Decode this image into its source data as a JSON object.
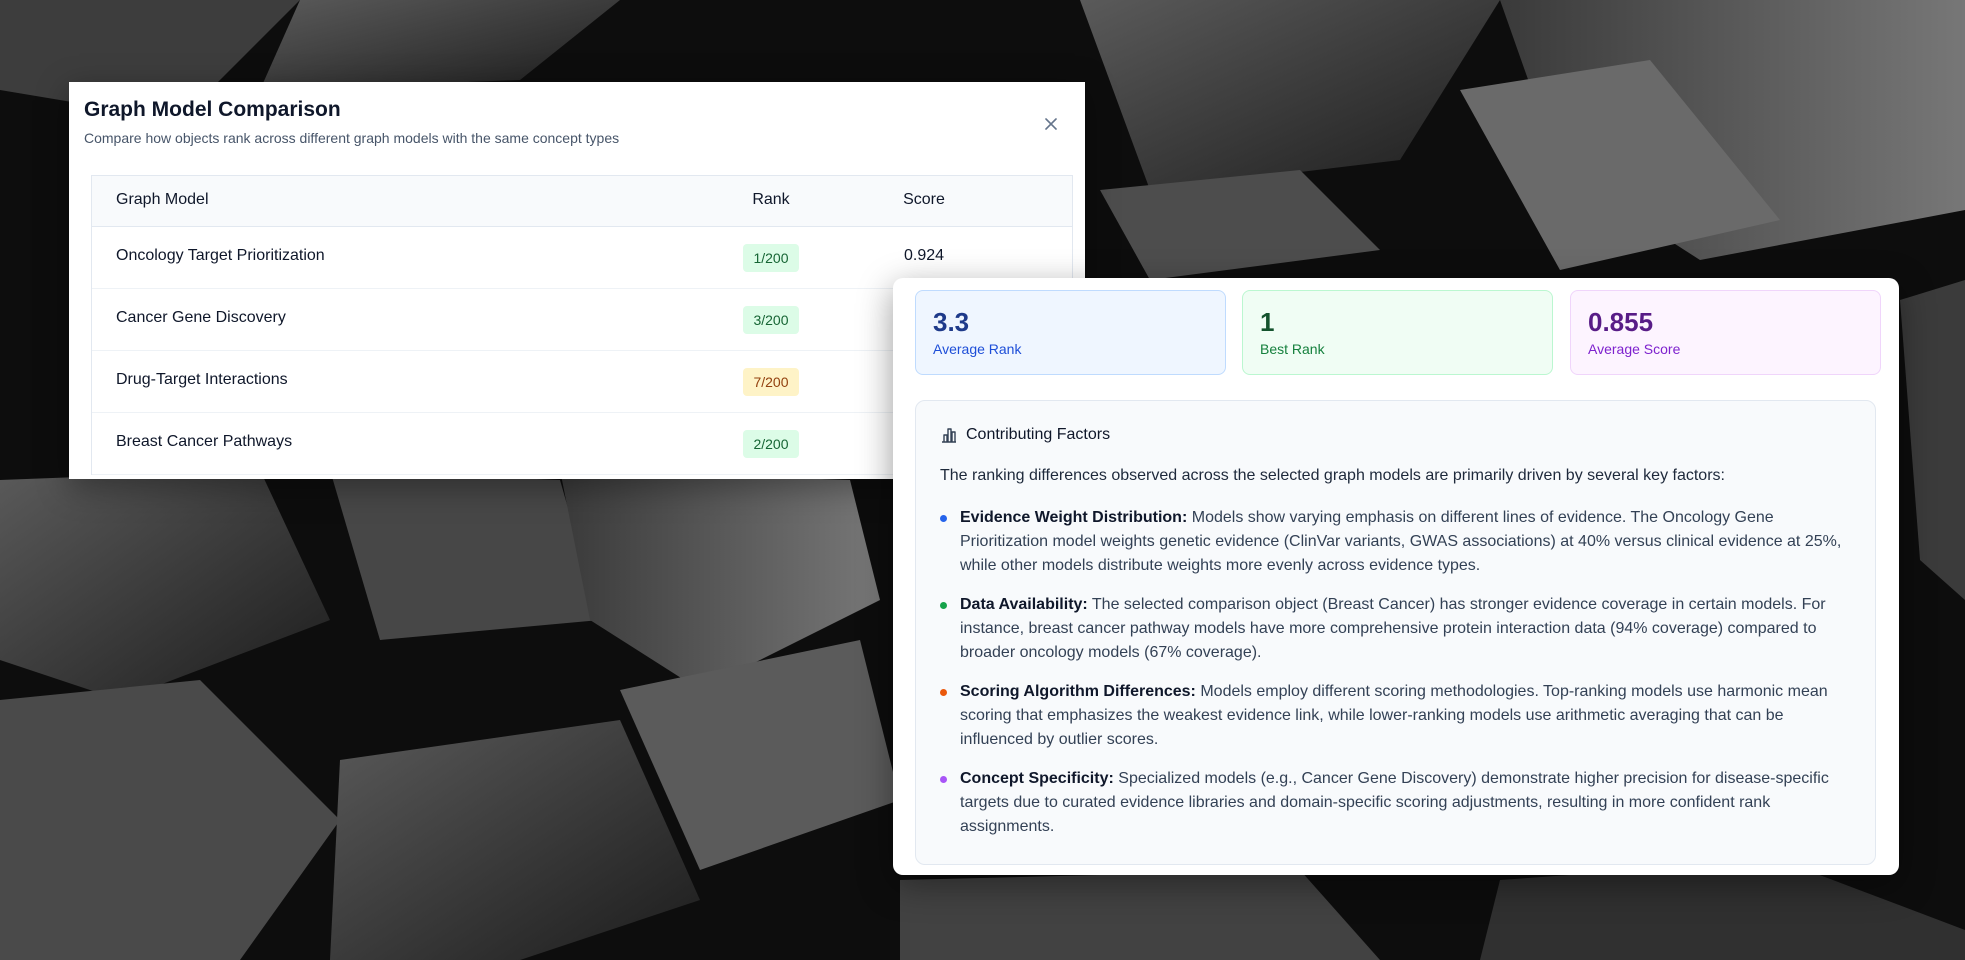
{
  "comparison": {
    "title": "Graph Model Comparison",
    "subtitle": "Compare how objects rank across different graph models with the same concept types",
    "close_icon": "close-icon",
    "columns": [
      "Graph Model",
      "Rank",
      "Score"
    ],
    "rows": [
      {
        "model": "Oncology Target Prioritization",
        "rank": "1/200",
        "rank_color": "green",
        "score": "0.924"
      },
      {
        "model": "Cancer Gene Discovery",
        "rank": "3/200",
        "rank_color": "green",
        "score": ""
      },
      {
        "model": "Drug-Target Interactions",
        "rank": "7/200",
        "rank_color": "yellow",
        "score": ""
      },
      {
        "model": "Breast Cancer Pathways",
        "rank": "2/200",
        "rank_color": "green",
        "score": ""
      }
    ]
  },
  "stats": [
    {
      "value": "3.3",
      "label": "Average Rank",
      "color": "#1d4ed8"
    },
    {
      "value": "1",
      "label": "Best Rank",
      "color": "#15803d"
    },
    {
      "value": "0.855",
      "label": "Average Score",
      "color": "#7e22ce"
    }
  ],
  "factors": {
    "icon": "bar-chart-icon",
    "title": "Contributing Factors",
    "intro": "The ranking differences observed across the selected graph models are primarily driven by several key factors:",
    "items": [
      {
        "heading": "Evidence Weight Distribution:",
        "text": "Models show varying emphasis on different lines of evidence. The Oncology Gene Prioritization model weights genetic evidence (ClinVar variants, GWAS associations) at 40% versus clinical evidence at 25%, while other models distribute weights more evenly across evidence types.",
        "dot_color": "#2563eb"
      },
      {
        "heading": "Data Availability:",
        "text": "The selected comparison object (Breast Cancer) has stronger evidence coverage in certain models. For instance, breast cancer pathway models have more comprehensive protein interaction data (94% coverage) compared to broader oncology models (67% coverage).",
        "dot_color": "#16a34a"
      },
      {
        "heading": "Scoring Algorithm Differences:",
        "text": "Models employ different scoring methodologies. Top-ranking models use harmonic mean scoring that emphasizes the weakest evidence link, while lower-ranking models use arithmetic averaging that can be influenced by outlier scores.",
        "dot_color": "#ea580c"
      },
      {
        "heading": "Concept Specificity:",
        "text": "Specialized models (e.g., Cancer Gene Discovery) demonstrate higher precision for disease-specific targets due to curated evidence libraries and domain-specific scoring adjustments, resulting in more confident rank assignments.",
        "dot_color": "#a855f7"
      }
    ]
  }
}
